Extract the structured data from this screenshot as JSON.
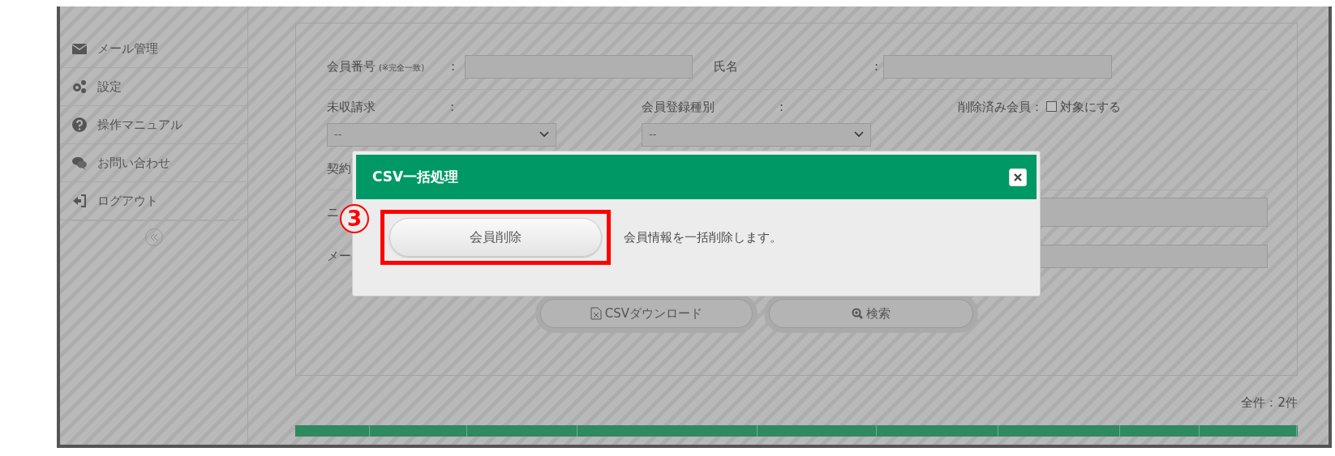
{
  "sidebar": {
    "items": [
      {
        "label": "メール管理"
      },
      {
        "label": "設定"
      },
      {
        "label": "操作マニュアル"
      },
      {
        "label": "お問い合わせ"
      },
      {
        "label": "ログアウト"
      }
    ]
  },
  "search_form": {
    "member_number": {
      "label": "会員番号",
      "note": "(※完全一致)",
      "colon": ":"
    },
    "name": {
      "label": "氏名",
      "colon": ":"
    },
    "unpaid": {
      "label": "未収請求",
      "colon": ":",
      "value": "--"
    },
    "registration_type": {
      "label": "会員登録種別",
      "colon": ":",
      "value": "--"
    },
    "deleted": {
      "label": "削除済み会員：",
      "option": "対象にする",
      "checked": false
    },
    "covered_labels": [
      "契約",
      "ニ",
      "メー"
    ],
    "buttons": [
      "CSVダウンロード",
      "検索"
    ]
  },
  "total": "全件：2件",
  "modal": {
    "title": "CSV一括処理",
    "button": "会員削除",
    "description": "会員情報を一括削除します。",
    "callout": "3"
  }
}
